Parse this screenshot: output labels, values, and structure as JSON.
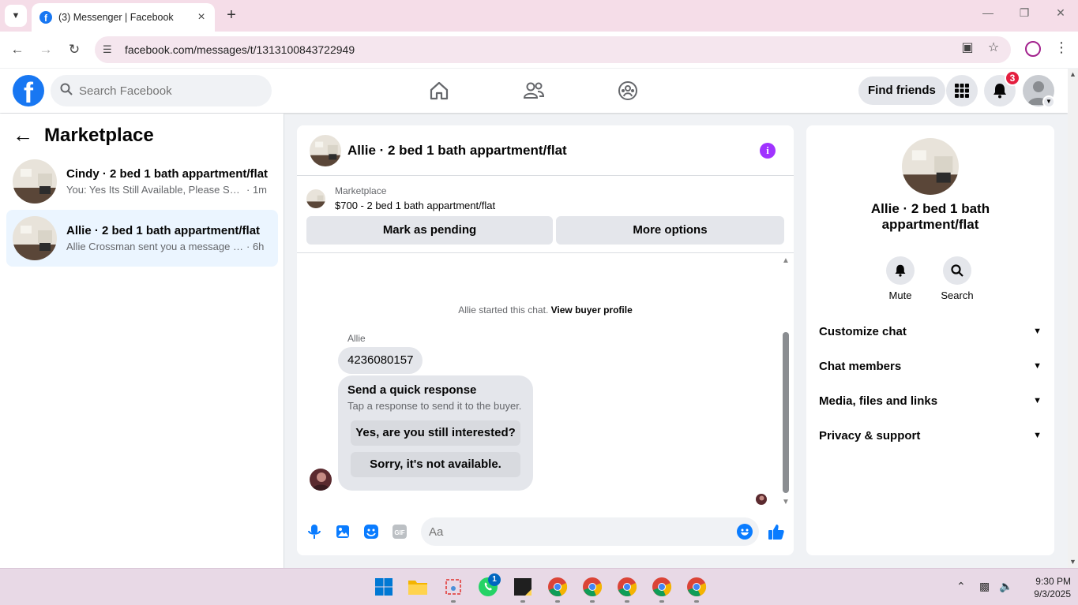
{
  "browser": {
    "tab_title": "(3) Messenger | Facebook",
    "url": "facebook.com/messages/t/1313100843722949"
  },
  "fb_header": {
    "search_placeholder": "Search Facebook",
    "find_friends": "Find friends",
    "notification_count": "3"
  },
  "left_panel": {
    "title": "Marketplace",
    "conversations": [
      {
        "name": "Cindy · 2 bed 1 bath appartment/flat",
        "preview": "You: Yes Its Still Available, Please Sen...",
        "time": "· 1m",
        "active": false
      },
      {
        "name": "Allie · 2 bed 1 bath appartment/flat",
        "preview": "Allie Crossman sent you a message ab...",
        "time": "· 6h",
        "active": true
      }
    ]
  },
  "chat": {
    "title": "Allie · 2 bed 1 bath appartment/flat",
    "marketplace_label": "Marketplace",
    "listing": "$700 - 2 bed 1 bath appartment/flat",
    "mark_pending": "Mark as pending",
    "more_options": "More options",
    "started_text": "Allie started this chat.",
    "view_buyer_profile": "View buyer profile",
    "sender": "Allie",
    "message": "4236080157",
    "quick_title": "Send a quick response",
    "quick_sub": "Tap a response to send it to the buyer.",
    "quick_1": "Yes, are you still interested?",
    "quick_2": "Sorry, it's not available.",
    "composer_placeholder": "Aa"
  },
  "right_panel": {
    "name": "Allie · 2 bed 1 bath appartment/flat",
    "mute": "Mute",
    "search": "Search",
    "sections": [
      "Customize chat",
      "Chat members",
      "Media, files and links",
      "Privacy & support"
    ]
  },
  "taskbar": {
    "time": "9:30 PM",
    "date": "9/3/2025",
    "whatsapp_badge": "1"
  },
  "colors": {
    "fb_blue": "#1877f2",
    "messenger_blue": "#0a7cff",
    "active_conv_bg": "#ebf5ff",
    "badge_red": "#e41e3f",
    "info_purple": "#a033ff"
  }
}
